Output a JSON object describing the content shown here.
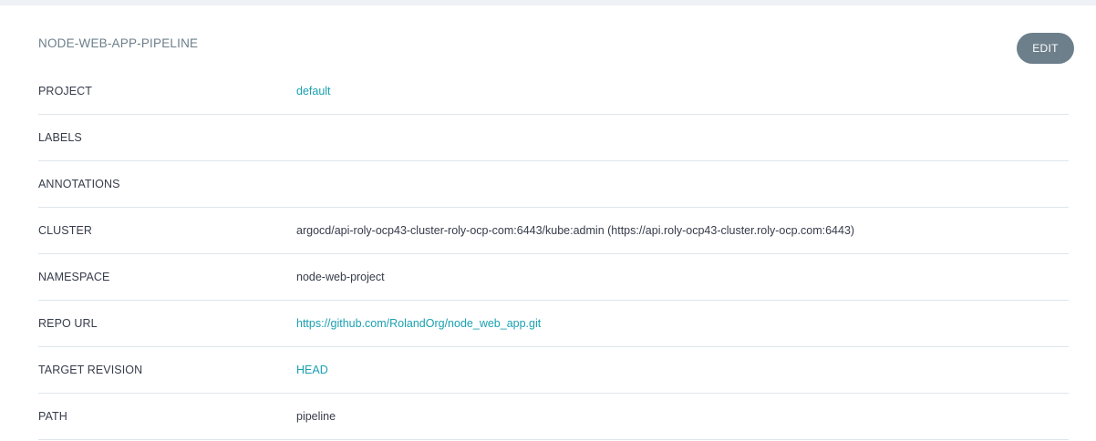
{
  "panel": {
    "title": "NODE-WEB-APP-PIPELINE",
    "edit_label": "EDIT"
  },
  "rows": [
    {
      "label": "PROJECT",
      "value": "default",
      "is_link": true
    },
    {
      "label": "LABELS",
      "value": "",
      "is_link": false
    },
    {
      "label": "ANNOTATIONS",
      "value": "",
      "is_link": false
    },
    {
      "label": "CLUSTER",
      "value": "argocd/api-roly-ocp43-cluster-roly-ocp-com:6443/kube:admin (https://api.roly-ocp43-cluster.roly-ocp.com:6443)",
      "is_link": false
    },
    {
      "label": "NAMESPACE",
      "value": "node-web-project",
      "is_link": false
    },
    {
      "label": "REPO URL",
      "value": "https://github.com/RolandOrg/node_web_app.git",
      "is_link": true
    },
    {
      "label": "TARGET REVISION",
      "value": "HEAD",
      "is_link": true
    },
    {
      "label": "PATH",
      "value": "pipeline",
      "is_link": false
    }
  ],
  "colors": {
    "link": "#1aa1b0",
    "button_bg": "#6d7f8b",
    "divider": "#dee6eb"
  }
}
